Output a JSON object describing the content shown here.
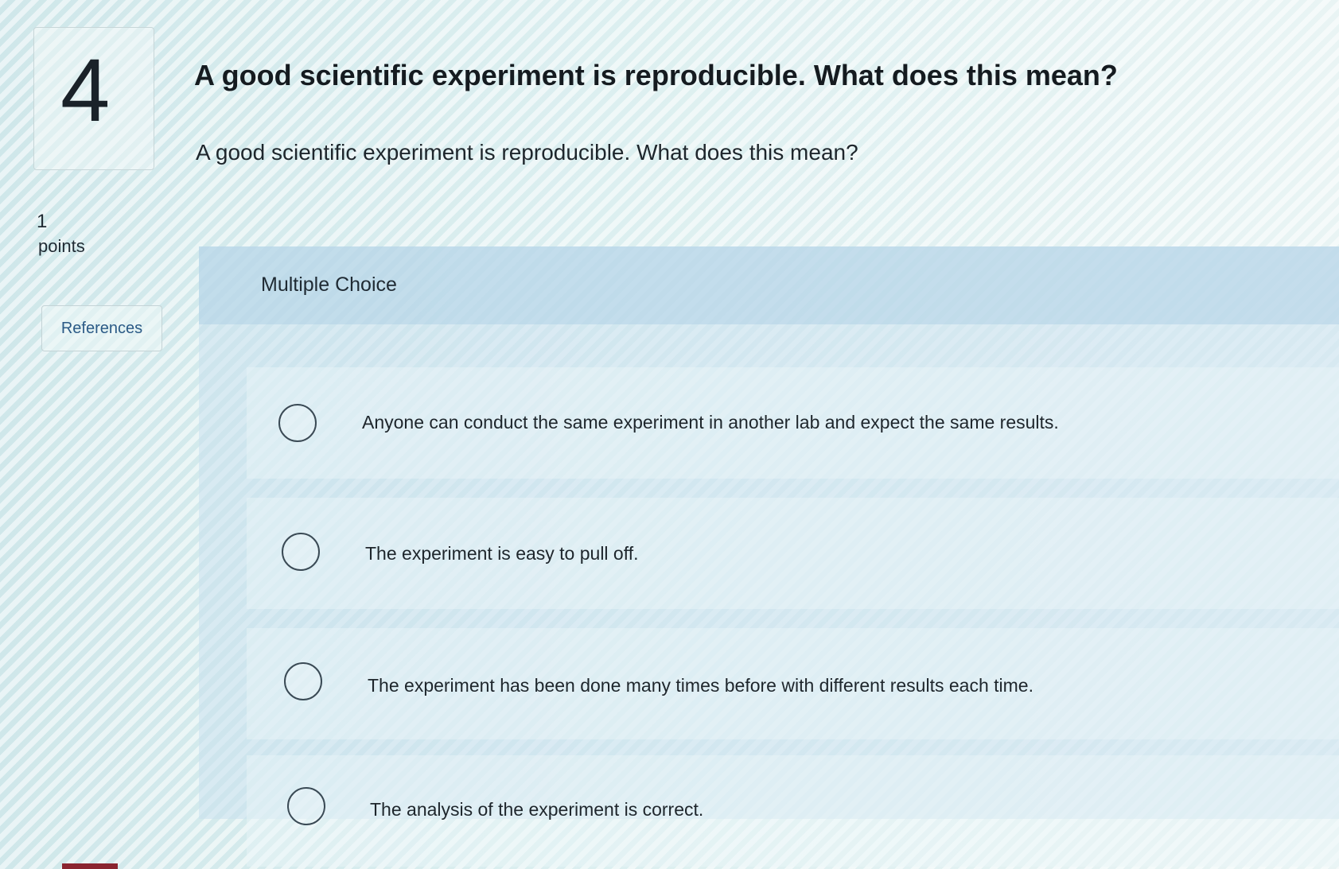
{
  "question": {
    "number": "4",
    "title": "A good scientific experiment is reproducible. What does this mean?",
    "text": "A good scientific experiment is reproducible. What does this mean?",
    "points_value": "1",
    "points_label": "points",
    "references_label": "References"
  },
  "answer_section": {
    "type_label": "Multiple Choice",
    "options": [
      {
        "text": "Anyone can conduct the same experiment in another lab and expect the same results.",
        "selected": false
      },
      {
        "text": "The experiment is easy to pull off.",
        "selected": false
      },
      {
        "text": "The experiment has been done many times before with different results each time.",
        "selected": false
      },
      {
        "text": "The analysis of the experiment is correct.",
        "selected": false
      }
    ]
  },
  "colors": {
    "background": "#d7ecee",
    "panel": "#c8e0ee",
    "text": "#1f2a33",
    "link": "#2b5a86"
  }
}
